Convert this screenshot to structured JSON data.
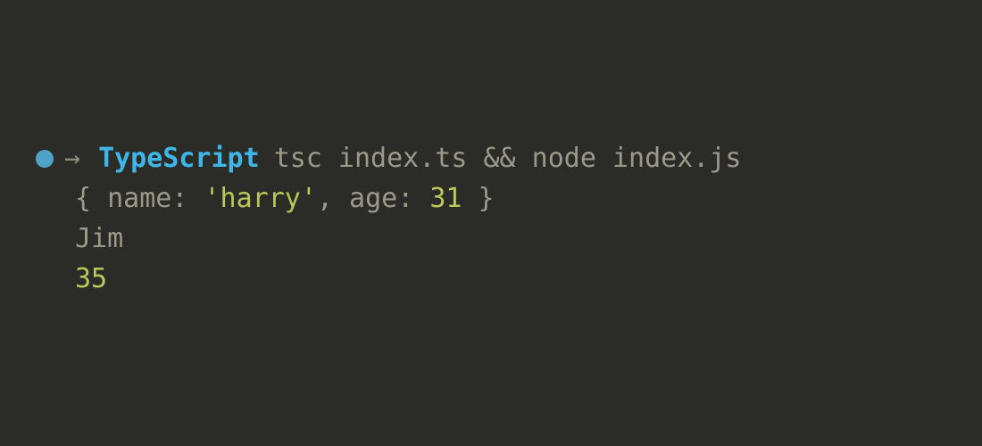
{
  "prompt": {
    "arrow_glyph": "→",
    "cwd": "TypeScript",
    "command": "tsc index.ts && node index.js"
  },
  "output": {
    "line1": {
      "open": "{ name: ",
      "name_value": "'harry'",
      "mid": ", age: ",
      "age_value": "31",
      "close": " }"
    },
    "line2": "Jim",
    "line3": "35"
  },
  "colors": {
    "background": "#2b2b28",
    "prompt_dot": "#4fa3c7",
    "cwd": "#3fb6e8",
    "default_text": "#9a9a8a",
    "string_number": "#b8c95a"
  }
}
